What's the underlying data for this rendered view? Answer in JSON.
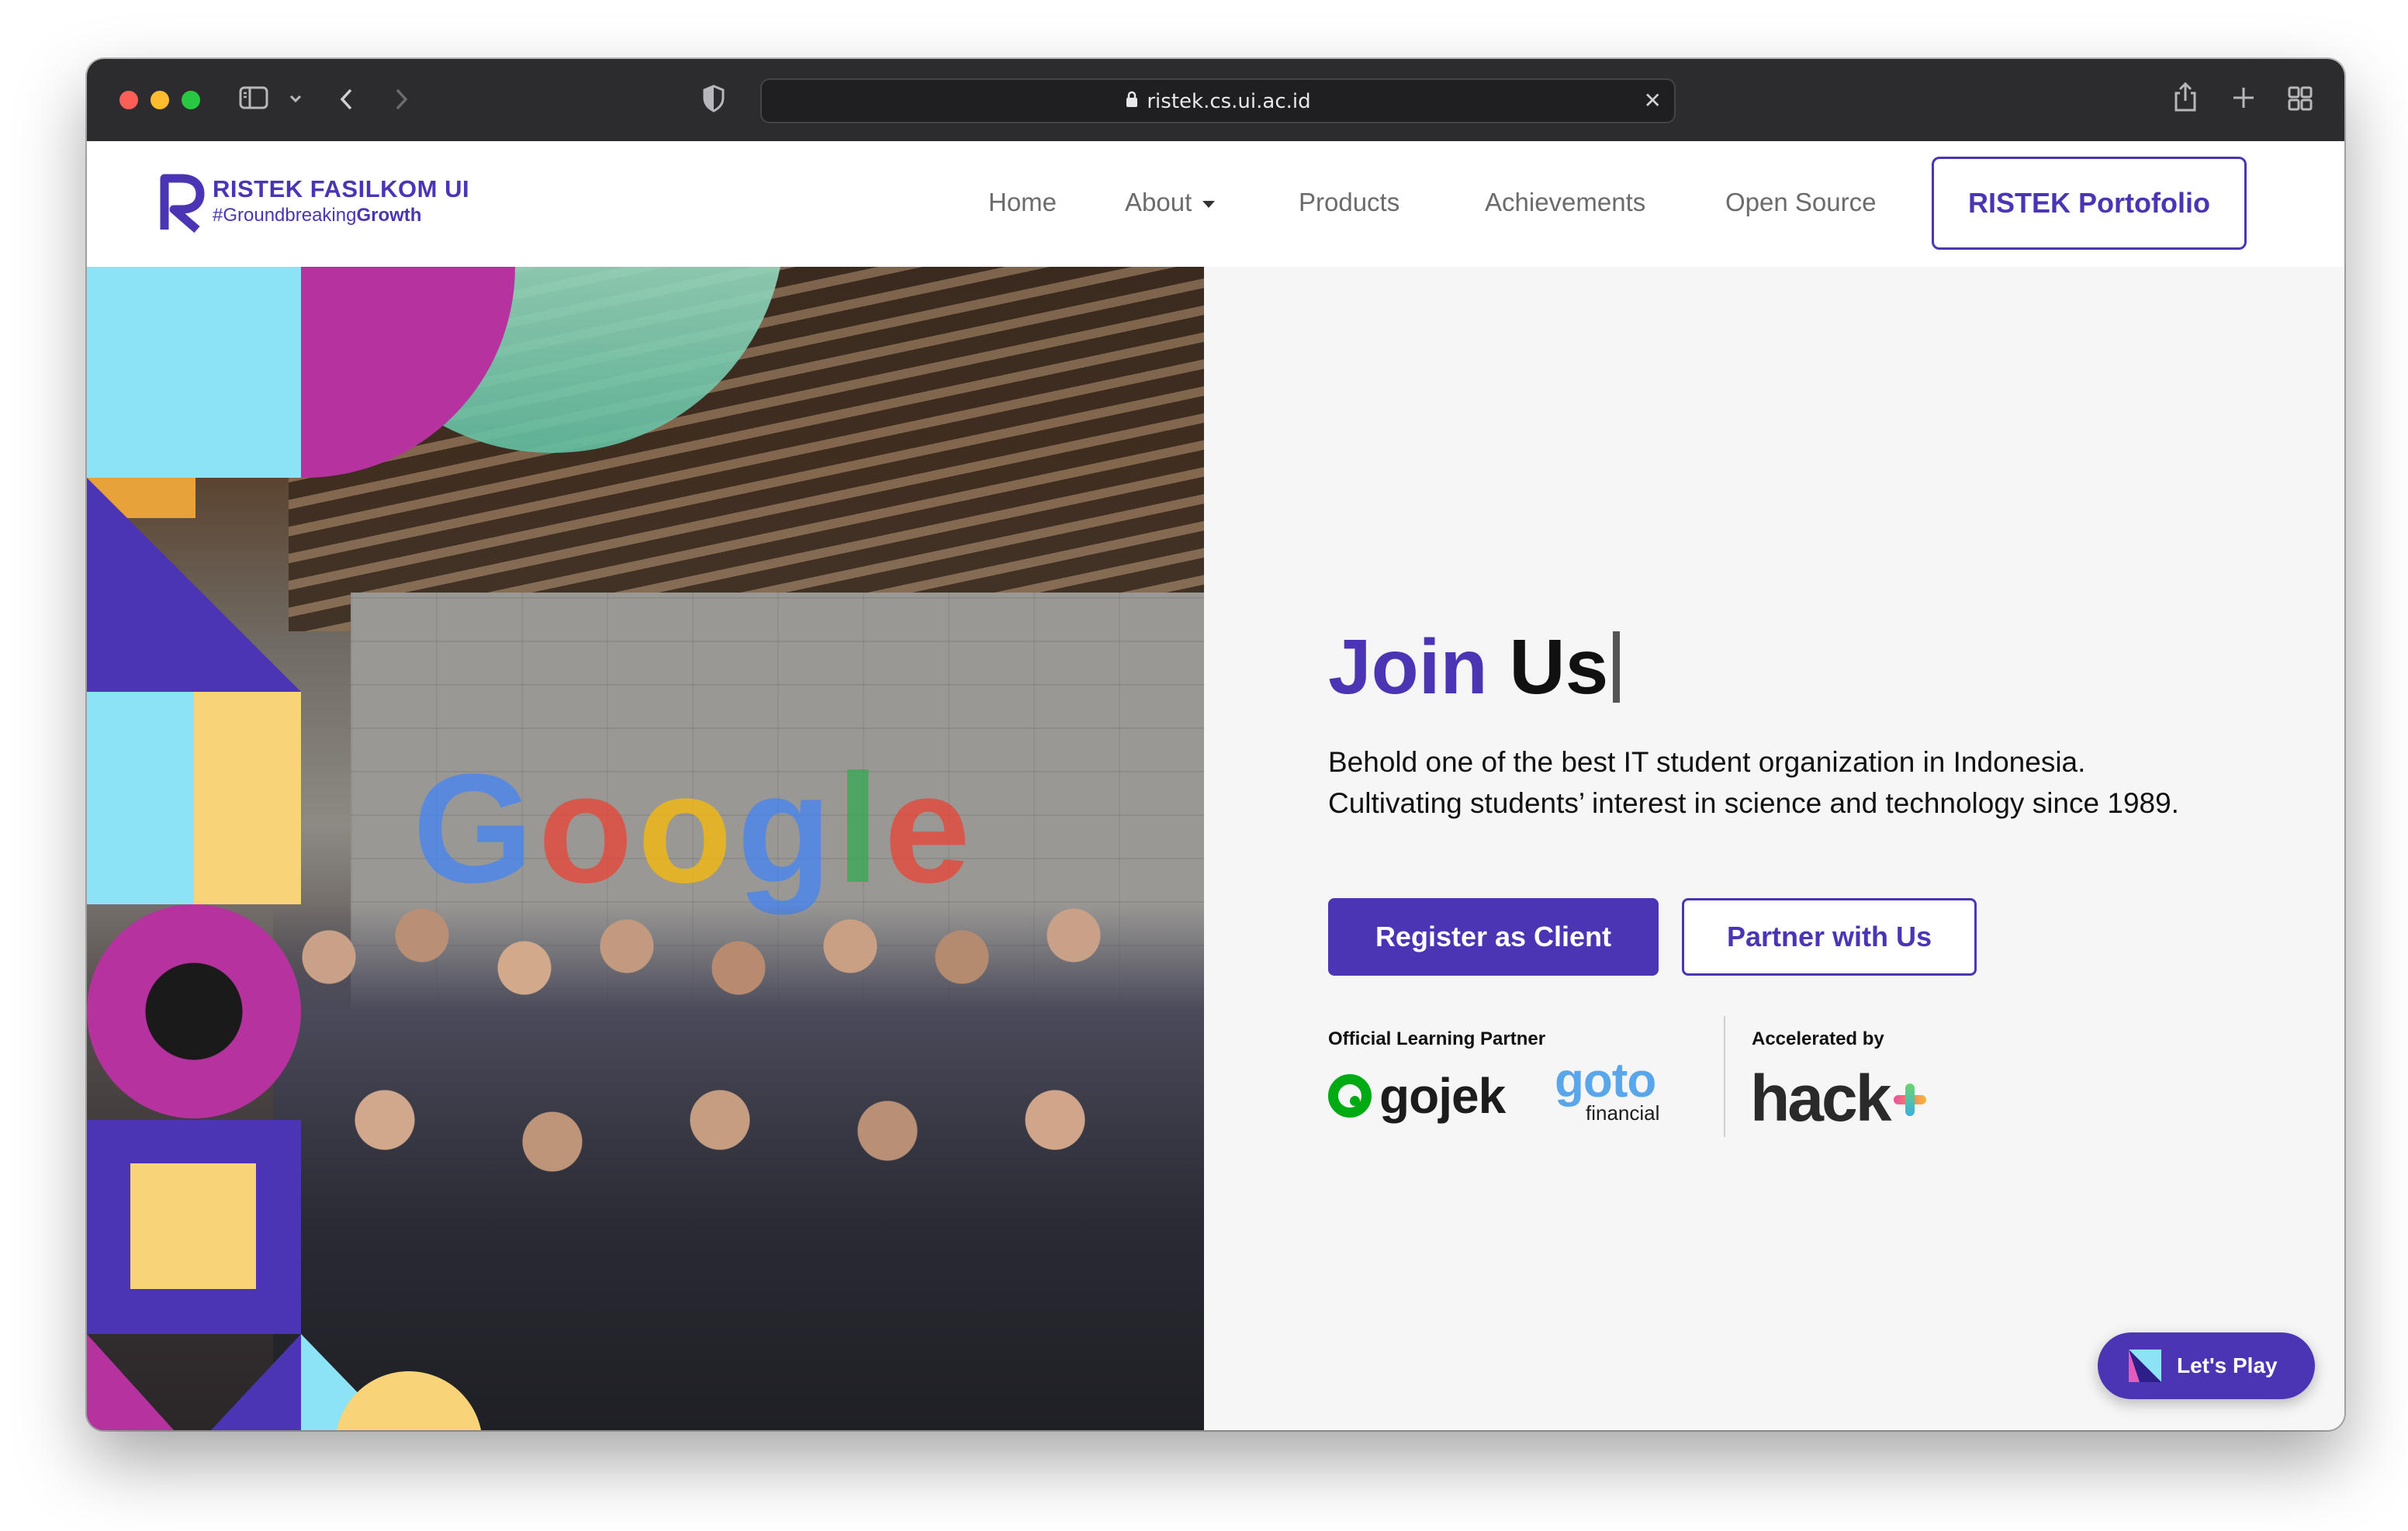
{
  "browser": {
    "url": "ristek.cs.ui.ac.id"
  },
  "brand": {
    "name": "RISTEK FASILKOM UI",
    "tagline_prefix": "#Groundbreaking",
    "tagline_bold": "Growth",
    "primary_color": "#4b35b5"
  },
  "nav": {
    "items": [
      "Home",
      "About",
      "Products",
      "Achievements",
      "Open Source"
    ],
    "cta": "RISTEK Portofolio"
  },
  "hero": {
    "photo_sign": "Google",
    "headline_accent": "Join",
    "headline_rest": "Us",
    "description_line1": "Behold one of the best IT student organization in Indonesia.",
    "description_line2": "Cultivating students’ interest in science and technology since 1989.",
    "primary_button": "Register as Client",
    "secondary_button": "Partner with Us"
  },
  "partners": {
    "learning_label": "Official Learning Partner",
    "accelerated_label": "Accelerated by",
    "gojek": "gojek",
    "goto_main": "goto",
    "goto_sub": "financial",
    "hack": "hack"
  },
  "widget": {
    "label": "Let's Play"
  }
}
